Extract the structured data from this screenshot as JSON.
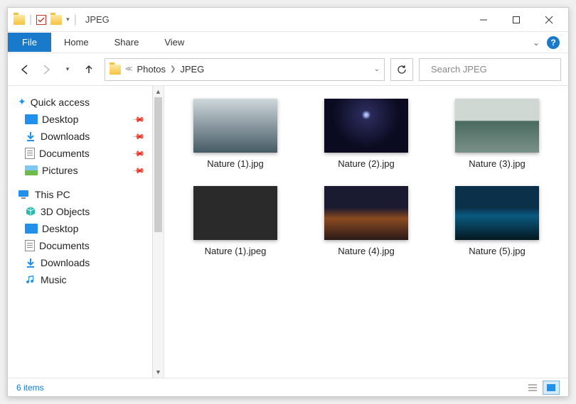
{
  "window": {
    "title": "JPEG"
  },
  "ribbon": {
    "file": "File",
    "tabs": [
      "Home",
      "Share",
      "View"
    ]
  },
  "breadcrumbs": [
    "Photos",
    "JPEG"
  ],
  "search": {
    "placeholder": "Search JPEG"
  },
  "sidebar": {
    "quick_access": "Quick access",
    "quick_items": [
      {
        "label": "Desktop",
        "icon": "desktop"
      },
      {
        "label": "Downloads",
        "icon": "download"
      },
      {
        "label": "Documents",
        "icon": "doc"
      },
      {
        "label": "Pictures",
        "icon": "pic"
      }
    ],
    "this_pc": "This PC",
    "pc_items": [
      {
        "label": "3D Objects",
        "icon": "3d"
      },
      {
        "label": "Desktop",
        "icon": "desktop"
      },
      {
        "label": "Documents",
        "icon": "doc"
      },
      {
        "label": "Downloads",
        "icon": "download"
      },
      {
        "label": "Music",
        "icon": "music"
      }
    ]
  },
  "files": [
    {
      "name": "Nature (1).jpg",
      "thumb": "t1"
    },
    {
      "name": "Nature (2).jpg",
      "thumb": "t2"
    },
    {
      "name": "Nature (3).jpg",
      "thumb": "t3"
    },
    {
      "name": "Nature (1).jpeg",
      "thumb": "t4"
    },
    {
      "name": "Nature (4).jpg",
      "thumb": "t5"
    },
    {
      "name": "Nature (5).jpg",
      "thumb": "t6"
    }
  ],
  "status": {
    "count": "6 items"
  }
}
